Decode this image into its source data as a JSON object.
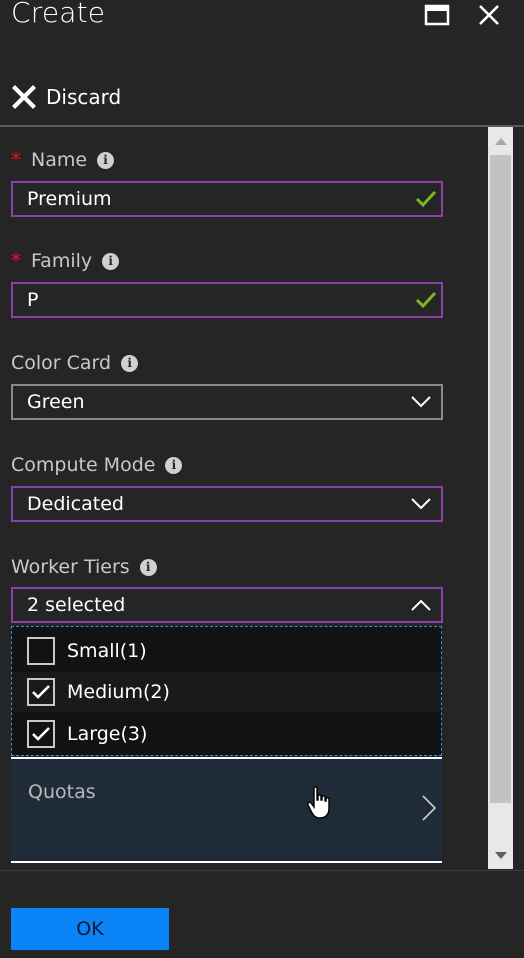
{
  "header": {
    "title": "Create",
    "maximize_icon": "maximize-icon",
    "close_icon": "close-icon"
  },
  "toolbar": {
    "discard_label": "Discard"
  },
  "form": {
    "name": {
      "label": "Name",
      "required": "*",
      "value": "Premium"
    },
    "family": {
      "label": "Family",
      "required": "*",
      "value": "P"
    },
    "color_card": {
      "label": "Color Card",
      "value": "Green"
    },
    "compute_mode": {
      "label": "Compute Mode",
      "value": "Dedicated"
    },
    "worker_tiers": {
      "label": "Worker Tiers",
      "value": "2 selected",
      "options": [
        {
          "label": "Small(1)",
          "checked": false
        },
        {
          "label": "Medium(2)",
          "checked": true
        },
        {
          "label": "Large(3)",
          "checked": true
        }
      ]
    },
    "quotas": {
      "label": "Quotas"
    }
  },
  "footer": {
    "ok_label": "OK"
  },
  "colors": {
    "background": "#252526",
    "field_border_active": "#8c3fa8",
    "field_border": "#8a8a8a",
    "valid_check": "#7ab81e",
    "required": "#e81123",
    "ok_button": "#0b84f7",
    "quotas_bg": "#1f2b38"
  }
}
